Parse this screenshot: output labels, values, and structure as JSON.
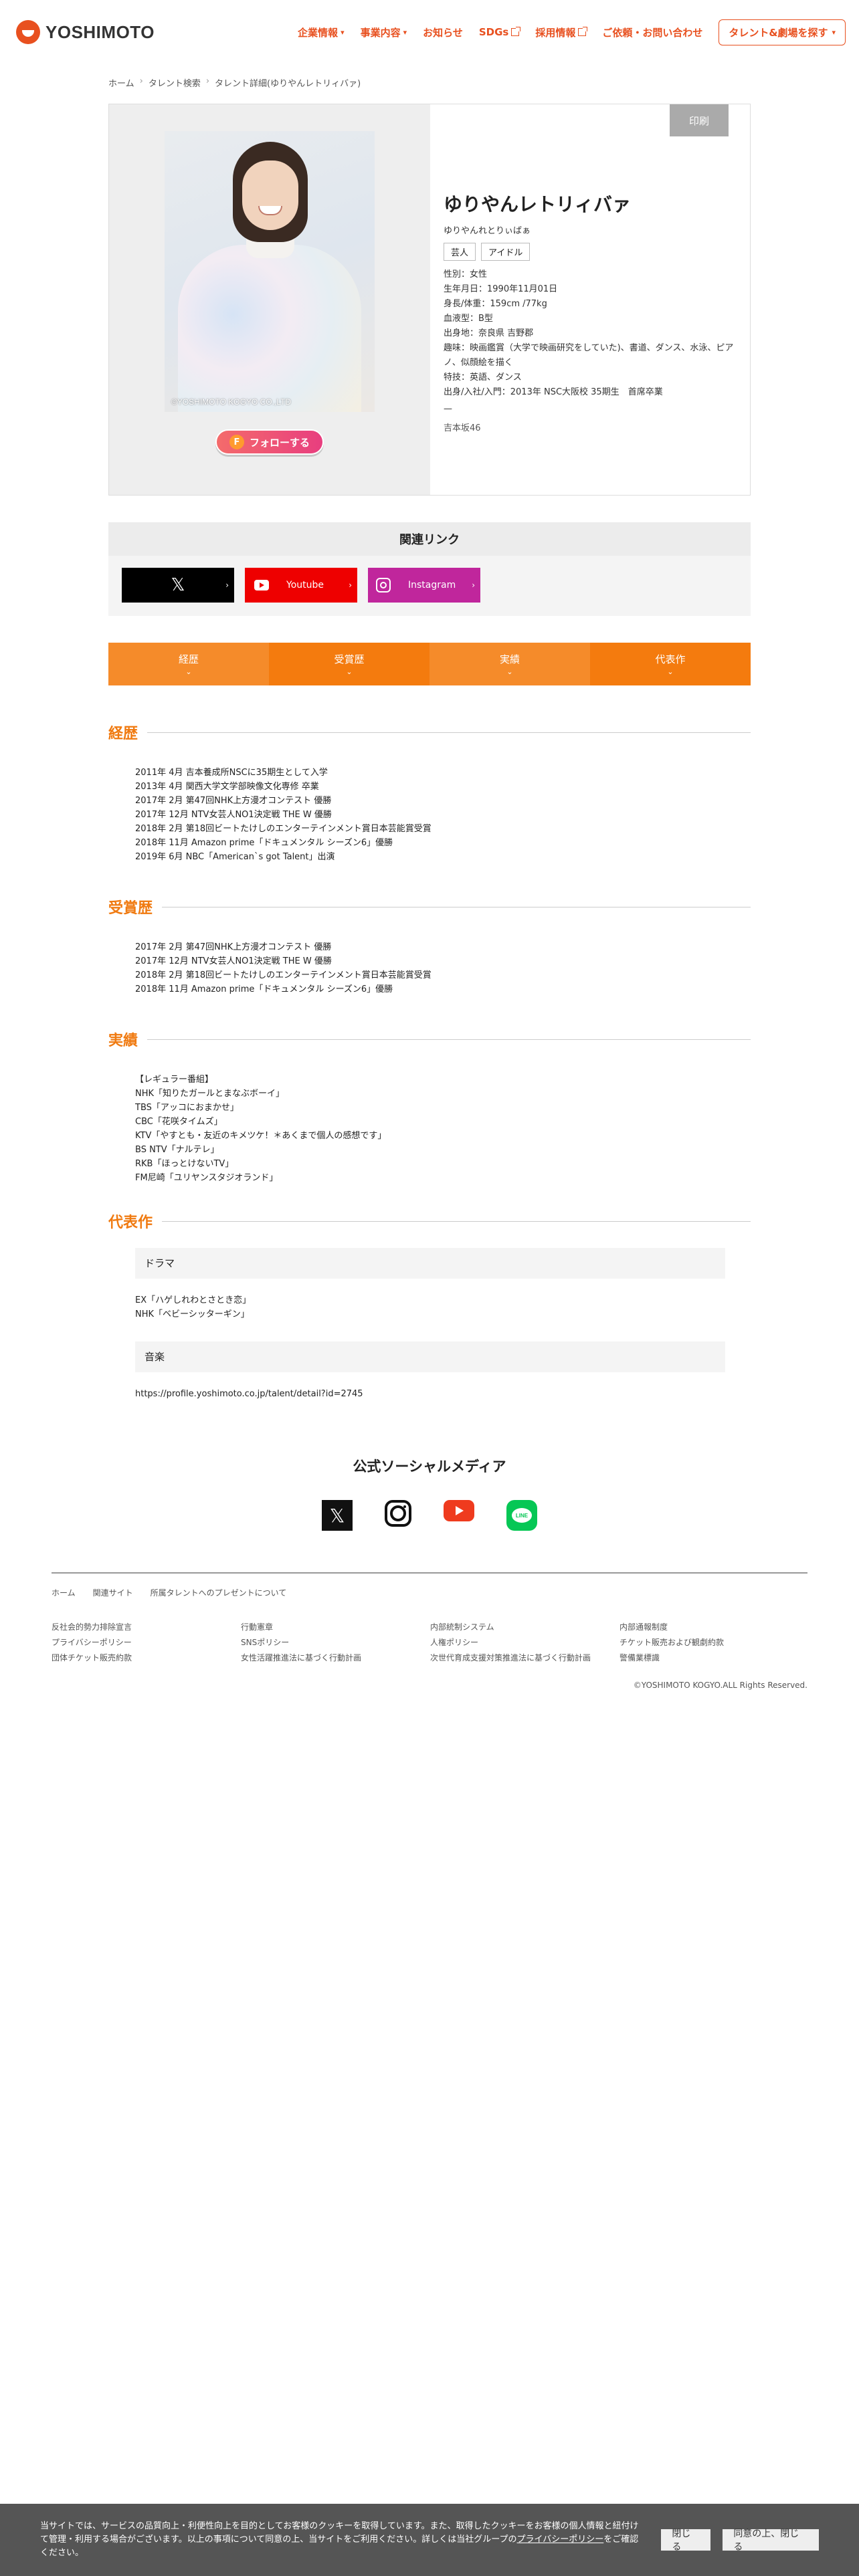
{
  "header": {
    "logo_text": "YOSHIMOTO",
    "nav": [
      {
        "label": "企業情報",
        "icon": "chevron-down"
      },
      {
        "label": "事業内容",
        "icon": "chevron-down"
      },
      {
        "label": "お知らせ",
        "icon": ""
      },
      {
        "label": "SDGs",
        "icon": "external-link"
      },
      {
        "label": "採用情報",
        "icon": "external-link"
      },
      {
        "label": "ご依頼・お問い合わせ",
        "icon": ""
      }
    ],
    "cta_label": "タレント&劇場を探す",
    "accent_color": "#e8501f"
  },
  "breadcrumb": [
    "ホーム",
    "タレント検索",
    "タレント詳細(ゆりやんレトリィバァ)"
  ],
  "profile": {
    "photo_credit": "©YOSHIMOTO KOGYO CO.,LTD",
    "follow_label": "フォローする",
    "follow_icon": "F",
    "print_label": "印刷",
    "name": "ゆりやんレトリィバァ",
    "kana": "ゆりやんれとりぃばぁ",
    "tags": [
      "芸人",
      "アイドル"
    ],
    "info": [
      "性別：女性",
      "生年月日：1990年11月01日",
      "身長/体重：159cm /77kg",
      "血液型：B型",
      "出身地：奈良県 吉野郡",
      "趣味：映画鑑賞（大学で映画研究をしていた)、書道、ダンス、水泳、ピア",
      "ノ、似顔絵を描く",
      "特技：英語、ダンス",
      "出身/入社/入門：2013年 NSC大阪校 35期生　首席卒業"
    ],
    "dash": "—",
    "group": "吉本坂46"
  },
  "related": {
    "title": "関連リンク",
    "links": [
      {
        "label": "",
        "icon": "x-icon"
      },
      {
        "label": "Youtube",
        "icon": "youtube-icon"
      },
      {
        "label": "Instagram",
        "icon": "instagram-icon"
      }
    ]
  },
  "tabs": [
    "経歴",
    "受賞歴",
    "実績",
    "代表作"
  ],
  "career": {
    "title": "経歴",
    "items": [
      "2011年 4月 吉本養成所NSCに35期生として入学",
      "2013年 4月 関西大学文学部映像文化専修 卒業",
      "2017年 2月 第47回NHK上方漫才コンテスト 優勝",
      "2017年 12月 NTV女芸人NO1決定戦 THE W 優勝",
      "2018年 2月 第18回ビートたけしのエンターテインメント賞日本芸能賞受賞",
      "2018年 11月 Amazon prime「ドキュメンタル シーズン6」優勝",
      "2019年 6月 NBC「American`s got Talent」出演"
    ]
  },
  "awards": {
    "title": "受賞歴",
    "items": [
      "2017年 2月 第47回NHK上方漫才コンテスト 優勝",
      "2017年 12月 NTV女芸人NO1決定戦 THE W 優勝",
      "2018年 2月 第18回ビートたけしのエンターテインメント賞日本芸能賞受賞",
      "2018年 11月 Amazon prime「ドキュメンタル シーズン6」優勝"
    ]
  },
  "achievements": {
    "title": "実績",
    "items": [
      "【レギュラー番組】",
      "NHK「知りたガールとまなぶボーイ」",
      "TBS「アッコにおまかせ」",
      "CBC「花咲タイムズ」",
      "KTV「やすとも・友近のキメツケ！＊あくまで個人の感想です」",
      "BS NTV「ナルテレ」",
      "RKB「ほっとけないTV」",
      "FM尼崎「ユリヤンスタジオランド」"
    ]
  },
  "works": {
    "title": "代表作",
    "groups": [
      {
        "heading": "ドラマ",
        "items": [
          "EX「ハゲしれわとさとき恋」",
          "NHK「ベビーシッターギン」"
        ]
      },
      {
        "heading": "音楽",
        "items": [
          "https://profile.yoshimoto.co.jp/talent/detail?id=2745"
        ]
      }
    ]
  },
  "social": {
    "title": "公式ソーシャルメディア",
    "icons": [
      "x-icon",
      "instagram-icon",
      "youtube-icon",
      "line-icon"
    ],
    "line_text": "LINE"
  },
  "footer": {
    "links": [
      "ホーム",
      "関連サイト",
      "所属タレントへのプレゼントについて"
    ],
    "grid": [
      "反社会的勢力排除宣言",
      "行動憲章",
      "内部統制システム",
      "内部通報制度",
      "プライバシーポリシー",
      "SNSポリシー",
      "人権ポリシー",
      "チケット販売および観劇約款",
      "団体チケット販売約款",
      "女性活躍推進法に基づく行動計画",
      "次世代育成支援対策推進法に基づく行動計画",
      "警備業標識"
    ],
    "copyright": "©YOSHIMOTO KOGYO.ALL Rights Reserved."
  },
  "cookie": {
    "text_before": "当サイトでは、サービスの品質向上・利便性向上を目的としてお客様のクッキーを取得しています。また、取得したクッキーをお客様の個人情報と紐付けて管理・利用する場合がございます。以上の事項について同意の上、当サイトをご利用ください。詳しくは当社グループの",
    "policy_link": "プライバシーポリシー",
    "text_after": "をご確認ください。",
    "close_label": "閉じる",
    "agree_label": "同意の上、閉じる"
  }
}
